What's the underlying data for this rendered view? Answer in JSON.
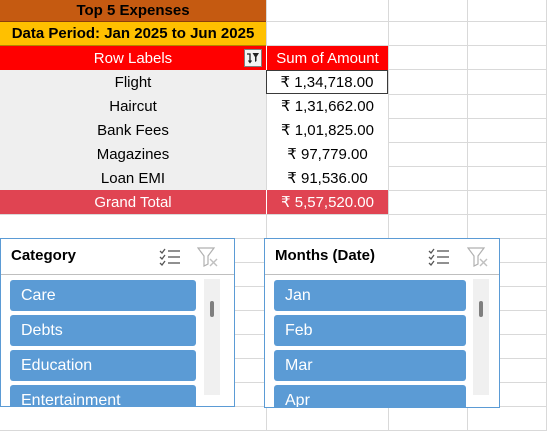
{
  "pivot": {
    "title": "Top 5 Expenses",
    "period": "Data Period: Jan 2025 to Jun 2025",
    "header_row_labels": "Row Labels",
    "header_sum": "Sum of Amount",
    "rows": [
      {
        "label": "Flight",
        "value": "₹ 1,34,718.00"
      },
      {
        "label": "Haircut",
        "value": "₹ 1,31,662.00"
      },
      {
        "label": "Bank Fees",
        "value": "₹ 1,01,825.00"
      },
      {
        "label": "Magazines",
        "value": "₹ 97,779.00"
      },
      {
        "label": "Loan EMI",
        "value": "₹ 91,536.00"
      }
    ],
    "grand_total_label": "Grand Total",
    "grand_total_value": "₹ 5,57,520.00"
  },
  "slicers": {
    "category": {
      "title": "Category",
      "items": [
        "Care",
        "Debts",
        "Education",
        "Entertainment"
      ]
    },
    "months": {
      "title": "Months (Date)",
      "items": [
        "Jan",
        "Feb",
        "Mar",
        "Apr"
      ]
    }
  },
  "colors": {
    "title_bg": "#c55a11",
    "period_bg": "#ffc000",
    "header_bg": "#ff0000",
    "grand_total_bg": "#e04452",
    "slicer_item": "#5b9bd5"
  },
  "icons": {
    "filter_button": "filter-sort-icon",
    "multi_select": "multi-select-icon",
    "clear_filter": "clear-filter-icon"
  }
}
